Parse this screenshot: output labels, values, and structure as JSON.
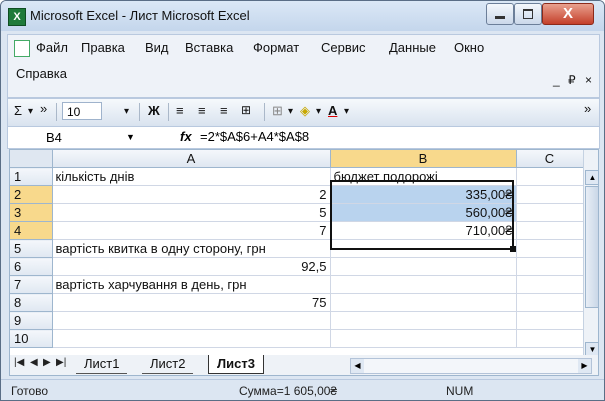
{
  "window": {
    "title": "Microsoft Excel - Лист Microsoft Excel",
    "close_glyph": "X"
  },
  "menu": {
    "items": [
      "Файл",
      "Правка",
      "Вид",
      "Вставка",
      "Формат",
      "Сервис",
      "Данные",
      "Окно",
      "Справка"
    ],
    "mdi_min": "_",
    "mdi_restore": "₽",
    "mdi_close": "×"
  },
  "toolbar": {
    "sum_label": "Σ",
    "font_size": "10",
    "bold_label": "Ж",
    "more_glyph": "»"
  },
  "formula_bar": {
    "name_box": "B4",
    "fx_label": "fx",
    "formula": "=2*$A$6+A4*$A$8"
  },
  "grid": {
    "columns": [
      "A",
      "B",
      "C"
    ],
    "rows": [
      {
        "num": "1",
        "a": "кількість днів",
        "b": "бюджет подорожі"
      },
      {
        "num": "2",
        "a": "2",
        "b": "335,00₴"
      },
      {
        "num": "3",
        "a": "5",
        "b": "560,00₴"
      },
      {
        "num": "4",
        "a": "7",
        "b": "710,00₴"
      },
      {
        "num": "5",
        "a": "вартість квитка в одну сторону, грн",
        "b": ""
      },
      {
        "num": "6",
        "a": "92,5",
        "b": ""
      },
      {
        "num": "7",
        "a": "вартість харчування в день, грн",
        "b": ""
      },
      {
        "num": "8",
        "a": "75",
        "b": ""
      },
      {
        "num": "9",
        "a": "",
        "b": ""
      },
      {
        "num": "10",
        "a": "",
        "b": ""
      }
    ]
  },
  "sheets": [
    "Лист1",
    "Лист2",
    "Лист3"
  ],
  "status": {
    "ready": "Готово",
    "sum": "Сумма=1 605,00₴",
    "num": "NUM"
  },
  "colors": {
    "selection": "#b9d3ee",
    "header_selected": "#f8d98c",
    "sheet_green": "#1f7a3a"
  }
}
